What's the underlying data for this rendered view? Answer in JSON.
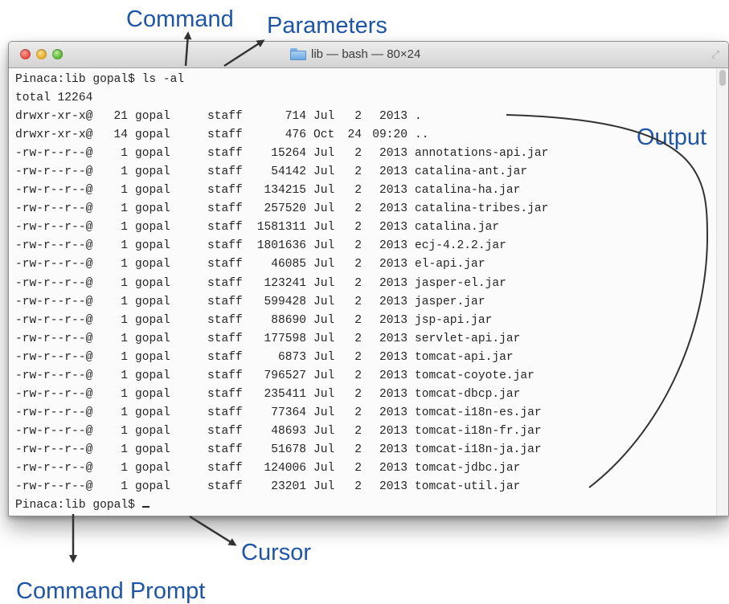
{
  "annotations": {
    "command": "Command",
    "parameters": "Parameters",
    "output": "Output",
    "cursor": "Cursor",
    "command_prompt": "Command Prompt"
  },
  "window": {
    "title": "lib — bash — 80×24",
    "title_icon": "folder-icon"
  },
  "terminal": {
    "command_line": "Pinaca:lib gopal$ ls -al",
    "total_line": "total 12264",
    "listing": [
      {
        "perm": "drwxr-xr-x@",
        "links": "21",
        "owner": "gopal",
        "group": "staff",
        "size": "714",
        "month": "Jul",
        "day": "2",
        "time": "2013",
        "name": "."
      },
      {
        "perm": "drwxr-xr-x@",
        "links": "14",
        "owner": "gopal",
        "group": "staff",
        "size": "476",
        "month": "Oct",
        "day": "24",
        "time": "09:20",
        "name": ".."
      },
      {
        "perm": "-rw-r--r--@",
        "links": "1",
        "owner": "gopal",
        "group": "staff",
        "size": "15264",
        "month": "Jul",
        "day": "2",
        "time": "2013",
        "name": "annotations-api.jar"
      },
      {
        "perm": "-rw-r--r--@",
        "links": "1",
        "owner": "gopal",
        "group": "staff",
        "size": "54142",
        "month": "Jul",
        "day": "2",
        "time": "2013",
        "name": "catalina-ant.jar"
      },
      {
        "perm": "-rw-r--r--@",
        "links": "1",
        "owner": "gopal",
        "group": "staff",
        "size": "134215",
        "month": "Jul",
        "day": "2",
        "time": "2013",
        "name": "catalina-ha.jar"
      },
      {
        "perm": "-rw-r--r--@",
        "links": "1",
        "owner": "gopal",
        "group": "staff",
        "size": "257520",
        "month": "Jul",
        "day": "2",
        "time": "2013",
        "name": "catalina-tribes.jar"
      },
      {
        "perm": "-rw-r--r--@",
        "links": "1",
        "owner": "gopal",
        "group": "staff",
        "size": "1581311",
        "month": "Jul",
        "day": "2",
        "time": "2013",
        "name": "catalina.jar"
      },
      {
        "perm": "-rw-r--r--@",
        "links": "1",
        "owner": "gopal",
        "group": "staff",
        "size": "1801636",
        "month": "Jul",
        "day": "2",
        "time": "2013",
        "name": "ecj-4.2.2.jar"
      },
      {
        "perm": "-rw-r--r--@",
        "links": "1",
        "owner": "gopal",
        "group": "staff",
        "size": "46085",
        "month": "Jul",
        "day": "2",
        "time": "2013",
        "name": "el-api.jar"
      },
      {
        "perm": "-rw-r--r--@",
        "links": "1",
        "owner": "gopal",
        "group": "staff",
        "size": "123241",
        "month": "Jul",
        "day": "2",
        "time": "2013",
        "name": "jasper-el.jar"
      },
      {
        "perm": "-rw-r--r--@",
        "links": "1",
        "owner": "gopal",
        "group": "staff",
        "size": "599428",
        "month": "Jul",
        "day": "2",
        "time": "2013",
        "name": "jasper.jar"
      },
      {
        "perm": "-rw-r--r--@",
        "links": "1",
        "owner": "gopal",
        "group": "staff",
        "size": "88690",
        "month": "Jul",
        "day": "2",
        "time": "2013",
        "name": "jsp-api.jar"
      },
      {
        "perm": "-rw-r--r--@",
        "links": "1",
        "owner": "gopal",
        "group": "staff",
        "size": "177598",
        "month": "Jul",
        "day": "2",
        "time": "2013",
        "name": "servlet-api.jar"
      },
      {
        "perm": "-rw-r--r--@",
        "links": "1",
        "owner": "gopal",
        "group": "staff",
        "size": "6873",
        "month": "Jul",
        "day": "2",
        "time": "2013",
        "name": "tomcat-api.jar"
      },
      {
        "perm": "-rw-r--r--@",
        "links": "1",
        "owner": "gopal",
        "group": "staff",
        "size": "796527",
        "month": "Jul",
        "day": "2",
        "time": "2013",
        "name": "tomcat-coyote.jar"
      },
      {
        "perm": "-rw-r--r--@",
        "links": "1",
        "owner": "gopal",
        "group": "staff",
        "size": "235411",
        "month": "Jul",
        "day": "2",
        "time": "2013",
        "name": "tomcat-dbcp.jar"
      },
      {
        "perm": "-rw-r--r--@",
        "links": "1",
        "owner": "gopal",
        "group": "staff",
        "size": "77364",
        "month": "Jul",
        "day": "2",
        "time": "2013",
        "name": "tomcat-i18n-es.jar"
      },
      {
        "perm": "-rw-r--r--@",
        "links": "1",
        "owner": "gopal",
        "group": "staff",
        "size": "48693",
        "month": "Jul",
        "day": "2",
        "time": "2013",
        "name": "tomcat-i18n-fr.jar"
      },
      {
        "perm": "-rw-r--r--@",
        "links": "1",
        "owner": "gopal",
        "group": "staff",
        "size": "51678",
        "month": "Jul",
        "day": "2",
        "time": "2013",
        "name": "tomcat-i18n-ja.jar"
      },
      {
        "perm": "-rw-r--r--@",
        "links": "1",
        "owner": "gopal",
        "group": "staff",
        "size": "124006",
        "month": "Jul",
        "day": "2",
        "time": "2013",
        "name": "tomcat-jdbc.jar"
      },
      {
        "perm": "-rw-r--r--@",
        "links": "1",
        "owner": "gopal",
        "group": "staff",
        "size": "23201",
        "month": "Jul",
        "day": "2",
        "time": "2013",
        "name": "tomcat-util.jar"
      }
    ],
    "prompt_line": "Pinaca:lib gopal$ "
  },
  "colors": {
    "annotation": "#1f55a6",
    "terminal_text": "#252525",
    "terminal_bg": "#fbfbfb"
  }
}
